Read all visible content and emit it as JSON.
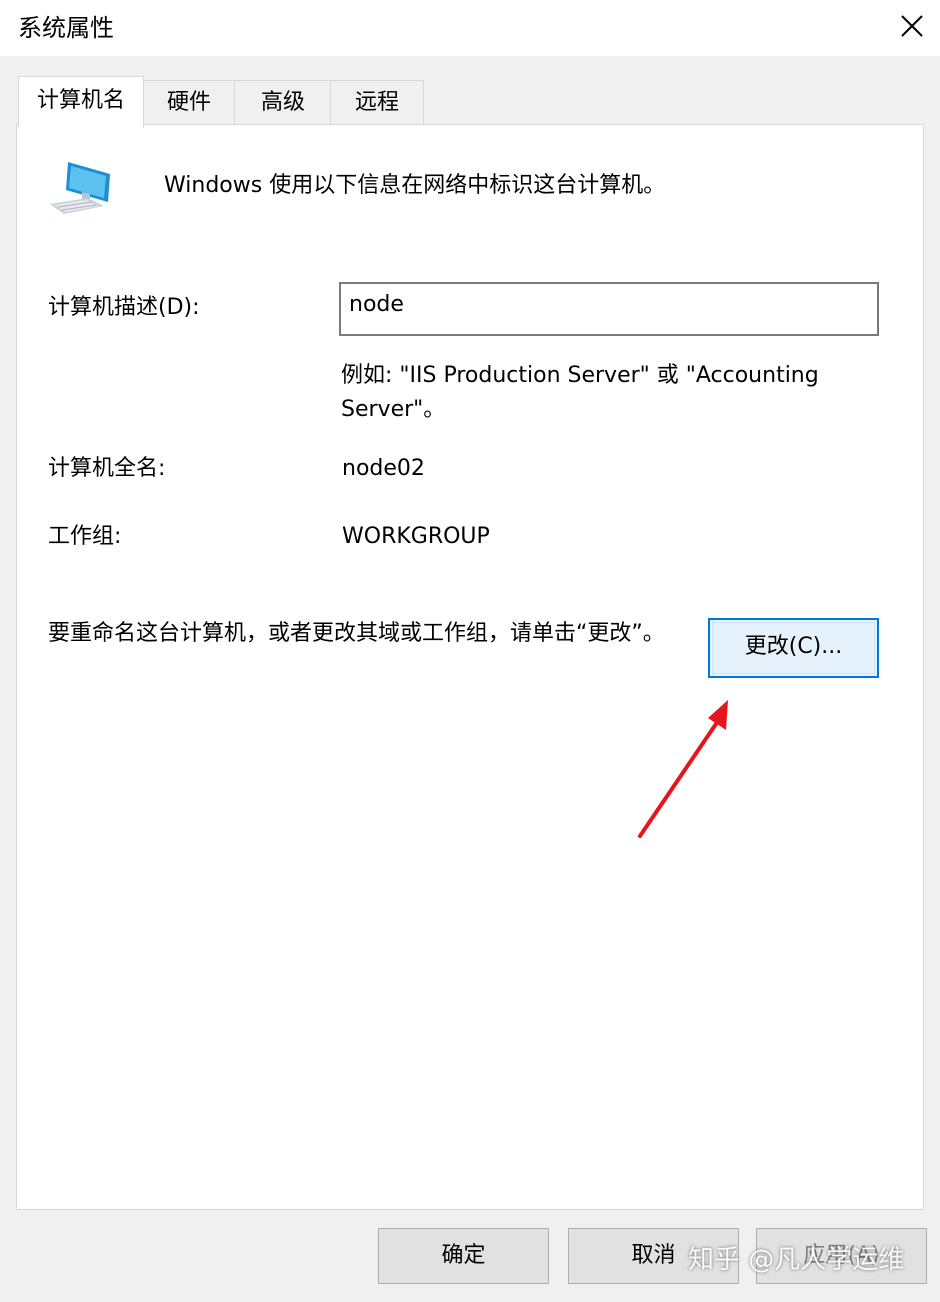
{
  "window": {
    "title": "系统属性"
  },
  "tabs": [
    {
      "label": "计算机名",
      "active": true
    },
    {
      "label": "硬件",
      "active": false
    },
    {
      "label": "高级",
      "active": false
    },
    {
      "label": "远程",
      "active": false
    }
  ],
  "main": {
    "intro": "Windows 使用以下信息在网络中标识这台计算机。",
    "description_label": "计算机描述(D):",
    "description_value": "node",
    "example_text": "例如: \"IIS Production Server\" 或 \"Accounting Server\"。",
    "full_name_label": "计算机全名:",
    "full_name_value": "node02",
    "workgroup_label": "工作组:",
    "workgroup_value": "WORKGROUP",
    "rename_note": "要重命名这台计算机，或者更改其域或工作组，请单击“更改”。",
    "change_button": "更改(C)..."
  },
  "footer": {
    "ok_label": "确定",
    "cancel_label": "取消",
    "apply_label": "应用(A)"
  },
  "watermark": "知乎 @凡人学运维",
  "icons": {
    "computer": "computer-icon",
    "close": "close-icon",
    "annotation": "red-arrow-icon"
  },
  "colors": {
    "focus_border": "#0078d7",
    "annotation_arrow": "#e8141b"
  }
}
